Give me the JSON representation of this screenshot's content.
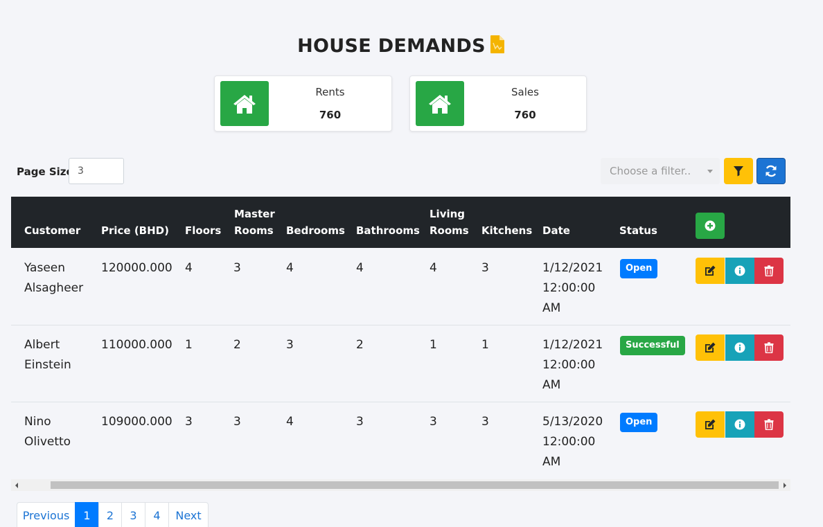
{
  "page": {
    "title": "HOUSE DEMANDS"
  },
  "cards": [
    {
      "label": "Rents",
      "value": "760",
      "icon": "home-icon"
    },
    {
      "label": "Sales",
      "value": "760",
      "icon": "home-icon"
    }
  ],
  "controls": {
    "page_size_label": "Page Size",
    "page_size_value": "3",
    "filter_placeholder": "Choose a filter.."
  },
  "table": {
    "headers": {
      "customer": "Customer",
      "price": "Price (BHD)",
      "floors": "Floors",
      "master_rooms_1": "Master",
      "master_rooms_2": "Rooms",
      "bedrooms": "Bedrooms",
      "bathrooms": "Bathrooms",
      "living_rooms_1": "Living",
      "living_rooms_2": "Rooms",
      "kitchens": "Kitchens",
      "date": "Date",
      "status": "Status"
    },
    "rows": [
      {
        "customer_1": "Yaseen",
        "customer_2": "Alsagheer",
        "price": "120000.000",
        "floors": "4",
        "master_rooms": "3",
        "bedrooms": "4",
        "bathrooms": "4",
        "living_rooms": "4",
        "kitchens": "3",
        "date_1": "1/12/2021",
        "date_2": "12:00:00",
        "date_3": "AM",
        "status": "Open"
      },
      {
        "customer_1": "Albert",
        "customer_2": "Einstein",
        "price": "110000.000",
        "floors": "1",
        "master_rooms": "2",
        "bedrooms": "3",
        "bathrooms": "2",
        "living_rooms": "1",
        "kitchens": "1",
        "date_1": "1/12/2021",
        "date_2": "12:00:00",
        "date_3": "AM",
        "status": "Successful"
      },
      {
        "customer_1": "Nino",
        "customer_2": "Olivetto",
        "price": "109000.000",
        "floors": "3",
        "master_rooms": "3",
        "bedrooms": "4",
        "bathrooms": "3",
        "living_rooms": "3",
        "kitchens": "3",
        "date_1": "5/13/2020",
        "date_2": "12:00:00",
        "date_3": "AM",
        "status": "Open"
      }
    ]
  },
  "pagination": {
    "previous": "Previous",
    "pages": [
      "1",
      "2",
      "3",
      "4"
    ],
    "next": "Next",
    "active_page": "1"
  },
  "colors": {
    "success": "#28a745",
    "primary": "#007bff",
    "warning": "#ffc107",
    "info": "#17a2b8",
    "danger": "#dc3545",
    "header_dark": "#212529"
  }
}
